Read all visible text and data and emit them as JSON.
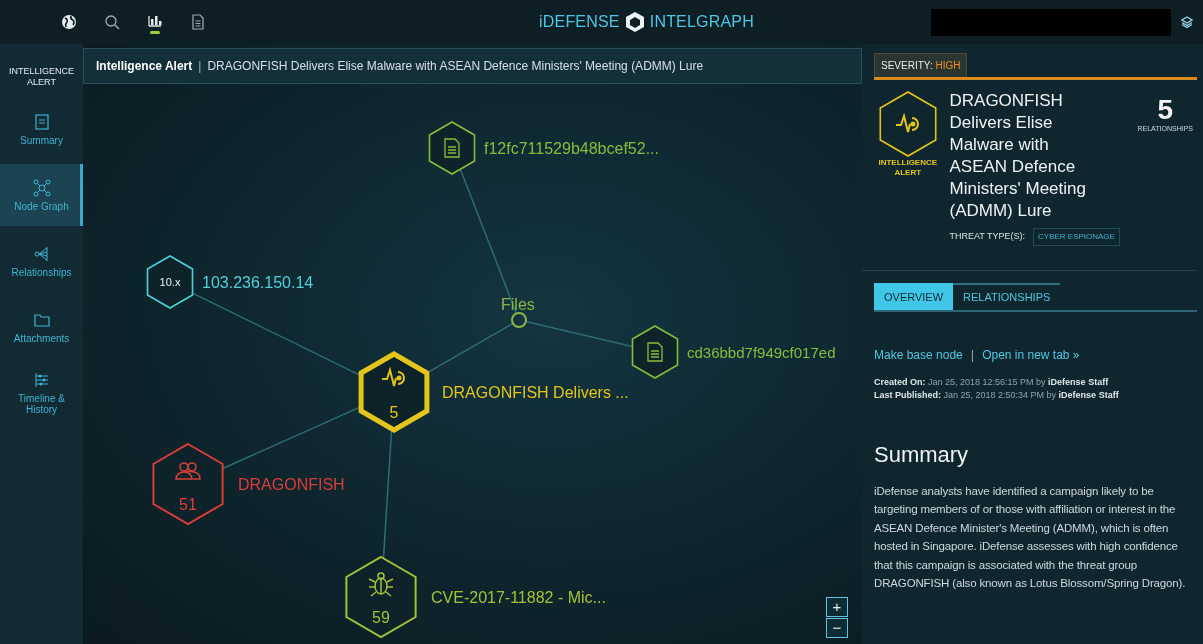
{
  "top_bar": {
    "tools": [
      {
        "kind": "globe",
        "selected": false
      },
      {
        "kind": "search",
        "selected": false
      },
      {
        "kind": "chart",
        "selected": true
      },
      {
        "kind": "document",
        "selected": false
      }
    ],
    "brand": {
      "left": "iDEFENSE",
      "right": "INTELGRAPH"
    }
  },
  "sidebar": {
    "header": "INTELLIGENCE ALERT",
    "items": [
      {
        "kind": "note",
        "label": "Summary",
        "selected": false
      },
      {
        "kind": "graph",
        "label": "Node Graph",
        "selected": true
      },
      {
        "kind": "relations",
        "label": "Relationships",
        "selected": false
      },
      {
        "kind": "folder",
        "label": "Attachments",
        "selected": false
      },
      {
        "kind": "timeline",
        "label": "Timeline & History",
        "selected": false
      }
    ]
  },
  "breadcrumb": {
    "section": "Intelligence Alert",
    "separator": "|",
    "title": "DRAGONFISH Delivers Elise Malware with ASEAN Defence Ministers' Meeting (ADMM) Lure"
  },
  "graph": {
    "center": {
      "kind": "alert",
      "label": "DRAGONFISH Delivers ...",
      "count": "5",
      "color": "#e3c51b"
    },
    "nodes": [
      {
        "kind": "ip",
        "badge": "10.x",
        "label": "103.236.150.14",
        "color": "#4fd0da"
      },
      {
        "kind": "group",
        "label": "Files",
        "color": "#8db544",
        "children": [
          {
            "kind": "file",
            "label": "f12fc711529b48bcef52...",
            "color": "#86bd3a"
          },
          {
            "kind": "file",
            "label": "cd36bbd7f949cf017ed",
            "color": "#86bd3a"
          }
        ]
      },
      {
        "kind": "actor",
        "label": "DRAGONFISH",
        "count": "51",
        "color": "#d93d3a"
      },
      {
        "kind": "vulnerability",
        "label": "CVE-2017-11882 - Mic...",
        "count": "59",
        "color": "#a3c236"
      }
    ],
    "zoom_controls": [
      "+",
      "−"
    ]
  },
  "panel": {
    "severity": {
      "label": "SEVERITY:",
      "value": "HIGH"
    },
    "type_label": "INTELLIGENCE ALERT",
    "title": "DRAGONFISH Delivers Elise Malware with ASEAN Defence Ministers' Meeting (ADMM) Lure",
    "relationships": {
      "count": "5",
      "label": "RELATIONSHIPS"
    },
    "threat_types": {
      "label": "THREAT TYPE(S):",
      "tags": [
        "CYBER ESPIONAGE"
      ]
    },
    "tabs": [
      {
        "label": "OVERVIEW",
        "selected": true
      },
      {
        "label": "RELATIONSHIPS",
        "selected": false
      }
    ],
    "actions": [
      "Make base node",
      "Open in new tab »"
    ],
    "action_separator": "|",
    "meta": [
      "**Created On:** Jan 25, 2018 12:56:15 PM by **iDefense Staff**",
      "**Last Published:** Jan 25, 2018 2:50:34 PM by **iDefense Staff**"
    ],
    "summary_heading": "Summary",
    "summary": "iDefense analysts have identified a campaign likely to be targeting members of or those with affiliation or interest in the ASEAN Defence Minister's Meeting (ADMM), which is often hosted in Singapore. iDefense assesses with high confidence that this campaign is associated with the threat group DRAGONFISH (also known as Lotus Blossom/Spring Dragon)."
  }
}
